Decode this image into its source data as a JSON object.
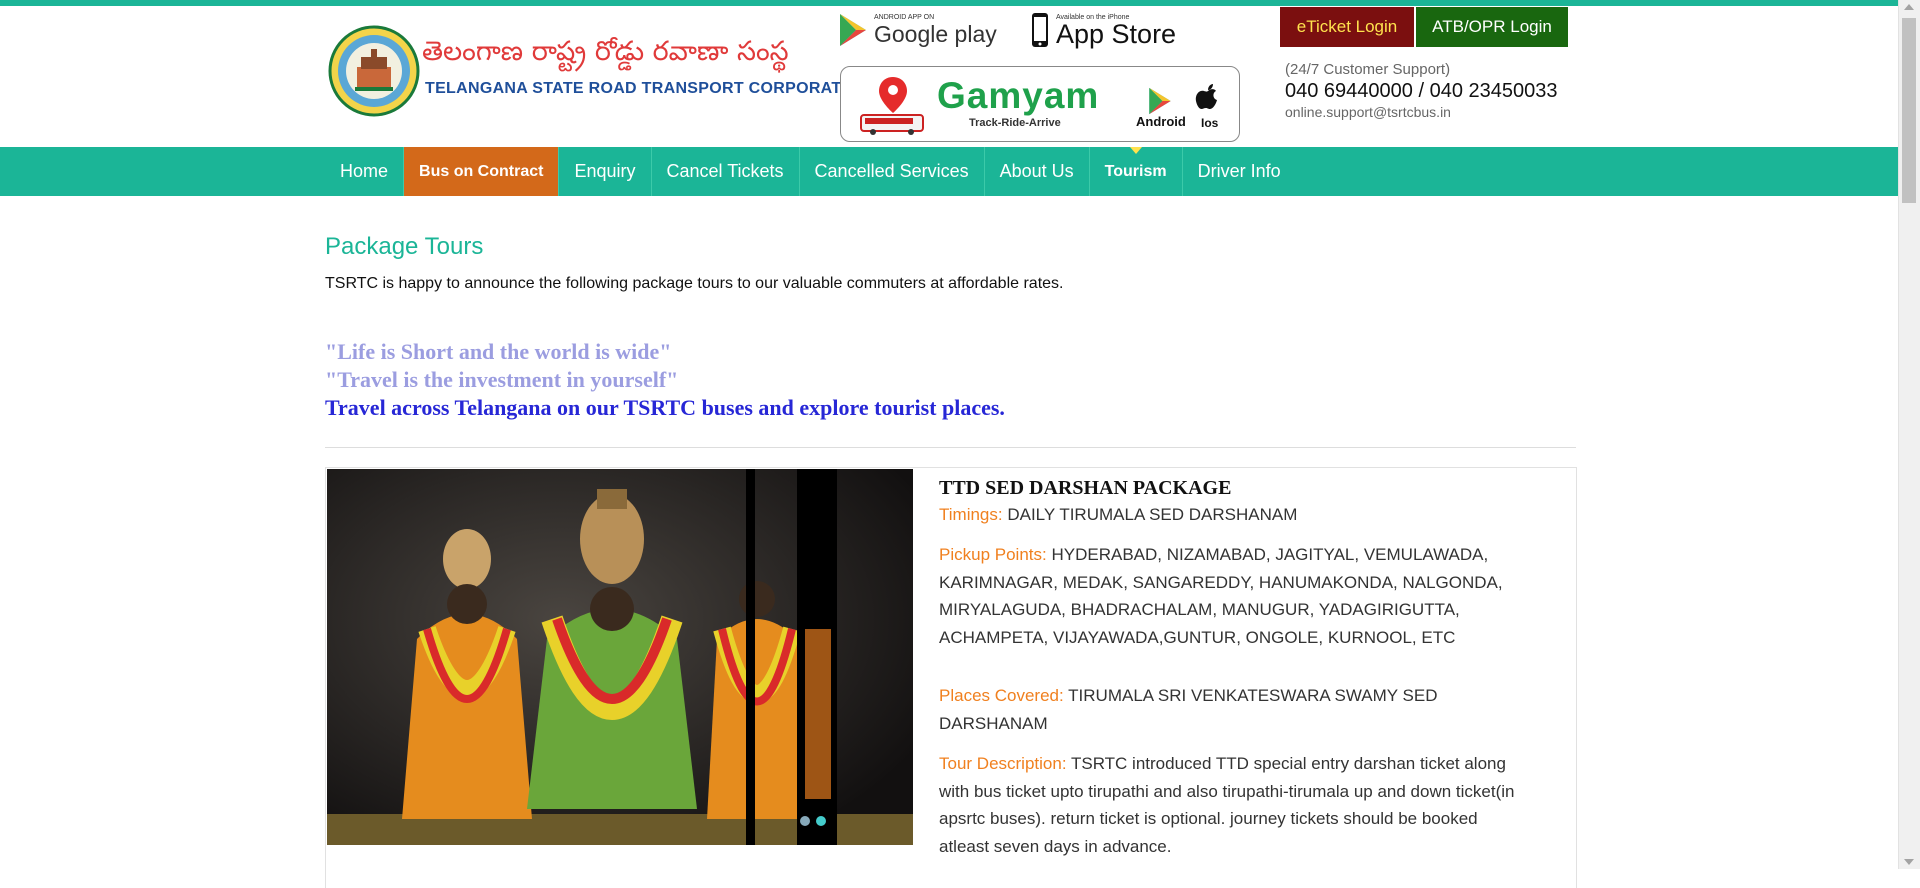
{
  "header": {
    "brand_telugu": "తెలంగాణ రాష్ట్ర రోడ్డు రవాణా సంస్థ",
    "brand_english": "TELANGANA STATE ROAD TRANSPORT CORPORATION",
    "google_play_small": "ANDROID APP ON",
    "google_play_label": "Google play",
    "app_store_small": "Available on the iPhone",
    "app_store_label": "App Store",
    "gamyam_title": "Gamyam",
    "gamyam_tagline": "Track-Ride-Arrive",
    "gamyam_android": "Android",
    "gamyam_ios": "Ios",
    "eticket_login": "eTicket Login",
    "atb_login": "ATB/OPR Login",
    "support_label": "(24/7 Customer Support)",
    "support_phone": "040 69440000 / 040 23450033",
    "support_email": "online.support@tsrtcbus.in"
  },
  "nav": {
    "items": [
      {
        "label": "Home"
      },
      {
        "label": "Bus on Contract"
      },
      {
        "label": "Enquiry"
      },
      {
        "label": "Cancel Tickets"
      },
      {
        "label": "Cancelled Services"
      },
      {
        "label": "About Us"
      },
      {
        "label": "Tourism"
      },
      {
        "label": "Driver Info"
      }
    ]
  },
  "main": {
    "title": "Package Tours",
    "intro": "TSRTC is happy to announce the following package tours to our valuable commuters at affordable rates.",
    "quote1": "\"Life is Short and the world is wide\"",
    "quote2": "\"Travel is the investment in yourself\"",
    "tagline": "Travel across Telangana on our TSRTC buses and explore tourist places."
  },
  "package": {
    "title": "TTD SED DARSHAN PACKAGE",
    "timings_label": "Timings:",
    "timings_value": "DAILY TIRUMALA SED DARSHANAM",
    "pickup_label": "Pickup Points:",
    "pickup_value": "HYDERABAD, NIZAMABAD, JAGITYAL, VEMULAWADA, KARIMNAGAR, MEDAK, SANGAREDDY, HANUMAKONDA, NALGONDA, MIRYALAGUDA, BHADRACHALAM, MANUGUR, YADAGIRIGUTTA, ACHAMPETA, VIJAYAWADA,GUNTUR, ONGOLE, KURNOOL, ETC",
    "places_label": "Places Covered:",
    "places_value": "TIRUMALA SRI VENKATESWARA SWAMY SED DARSHANAM",
    "desc_label": "Tour Description:",
    "desc_value": "TSRTC introduced TTD special entry darshan ticket along with bus ticket upto tirupathi and also tirupathi-tirumala up and down ticket(in apsrtc buses). return ticket is optional. journey tickets should be booked atleast seven days in advance."
  },
  "colors": {
    "brand_green": "#1bb597",
    "contract_orange": "#d3691a",
    "eticket_red": "#7b0f0f",
    "atb_green": "#19670f",
    "label_orange": "#f0801f",
    "quote_lavender": "#9b9de0",
    "tagline_blue": "#2727d6"
  }
}
